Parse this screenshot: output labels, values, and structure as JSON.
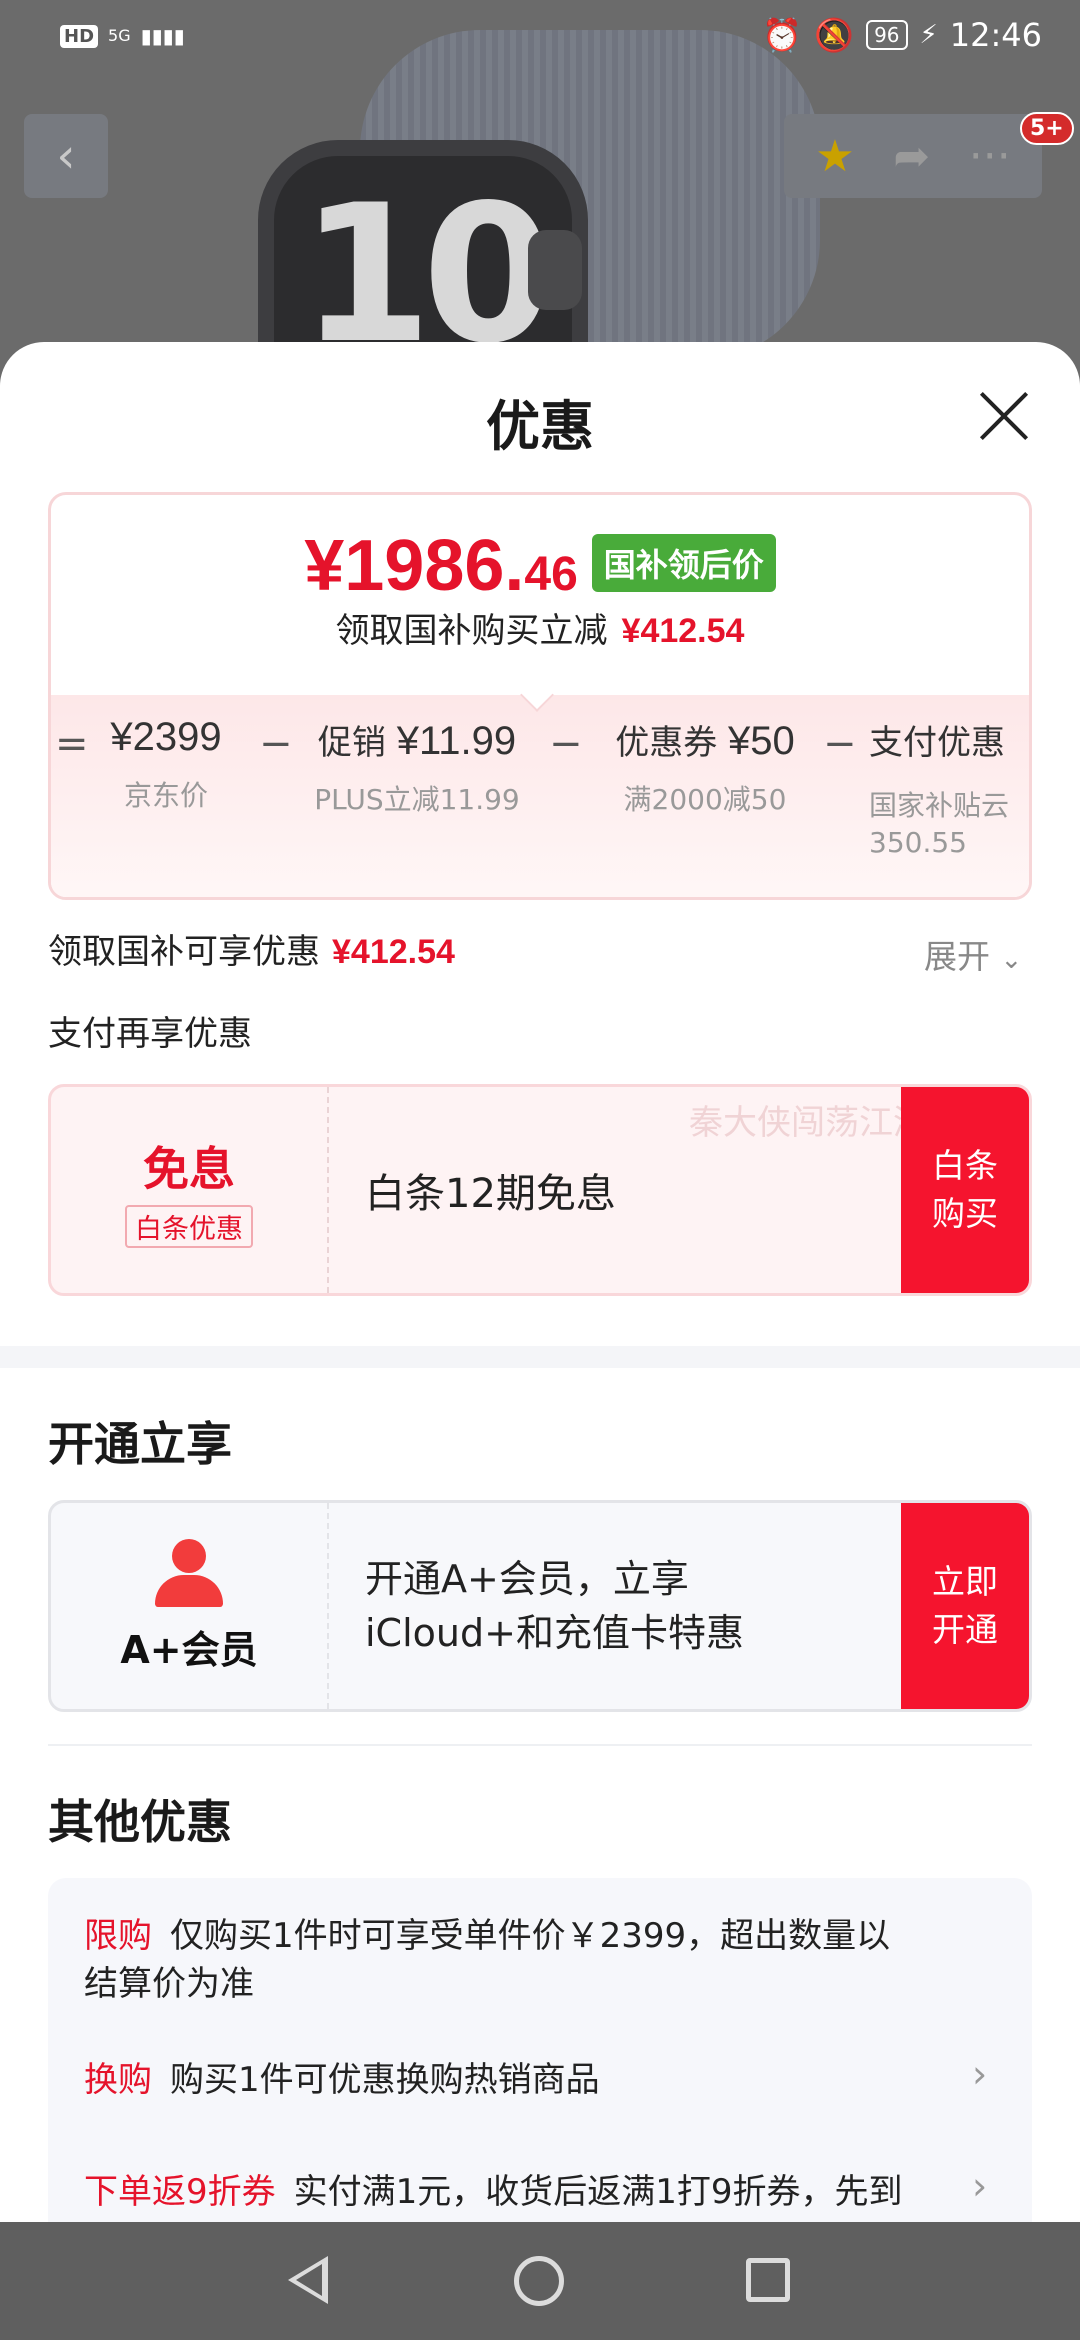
{
  "status": {
    "hd": "HD",
    "network": "5G",
    "battery": "96",
    "time": "12:46"
  },
  "background_page": {
    "watch_face_text": "10",
    "cart_badge": "5+"
  },
  "sheet": {
    "title": "优惠",
    "price_summary": {
      "final_price_main": "¥1986.",
      "final_price_decimal": "46",
      "final_price_tag": "国补领后价",
      "savings_label": "领取国补购买立减",
      "savings_value": "¥412.54",
      "breakdown": [
        {
          "top_label": "",
          "top_value": "¥2399",
          "sub": "京东价"
        },
        {
          "top_label": "促销 ",
          "top_value": "¥11.99",
          "sub": "PLUS立减11.99"
        },
        {
          "top_label": "优惠券 ",
          "top_value": "¥50",
          "sub": "满2000减50"
        },
        {
          "top_label": "支付优惠",
          "top_value": "",
          "sub": "国家补贴云",
          "sub2": "350.55"
        }
      ],
      "operators": [
        "=",
        "−",
        "−",
        "−"
      ]
    },
    "subsidy_line": {
      "label": "领取国补可享优惠",
      "value": "¥412.54"
    },
    "expand_label": "展开",
    "pay_section_title": "支付再享优惠",
    "baitiao_coupon": {
      "big": "免息",
      "chip": "白条优惠",
      "description": "白条12期免息",
      "watermark": "秦大侠闯荡江湖",
      "button_line1": "白条",
      "button_line2": "购买"
    },
    "open_section_title": "开通立享",
    "aplus_coupon": {
      "label": "A+会员",
      "line1": "开通A+会员，立享",
      "line2": "iCloud+和充值卡特惠",
      "button_line1": "立即",
      "button_line2": "开通"
    },
    "other_section_title": "其他优惠",
    "other_items": [
      {
        "tag": "限购",
        "text": "仅购买1件时可享受单件价￥2399，超出数量以",
        "text2": "结算价为准"
      },
      {
        "tag": "换购",
        "text": "购买1件可优惠换购热销商品"
      },
      {
        "tag": "下单返9折券",
        "text": "实付满1元，收货后返满1打9折券，先到"
      }
    ]
  },
  "colors": {
    "accent_red": "#e5132b",
    "button_red": "#f5142e",
    "tag_green": "#49ab3a"
  }
}
